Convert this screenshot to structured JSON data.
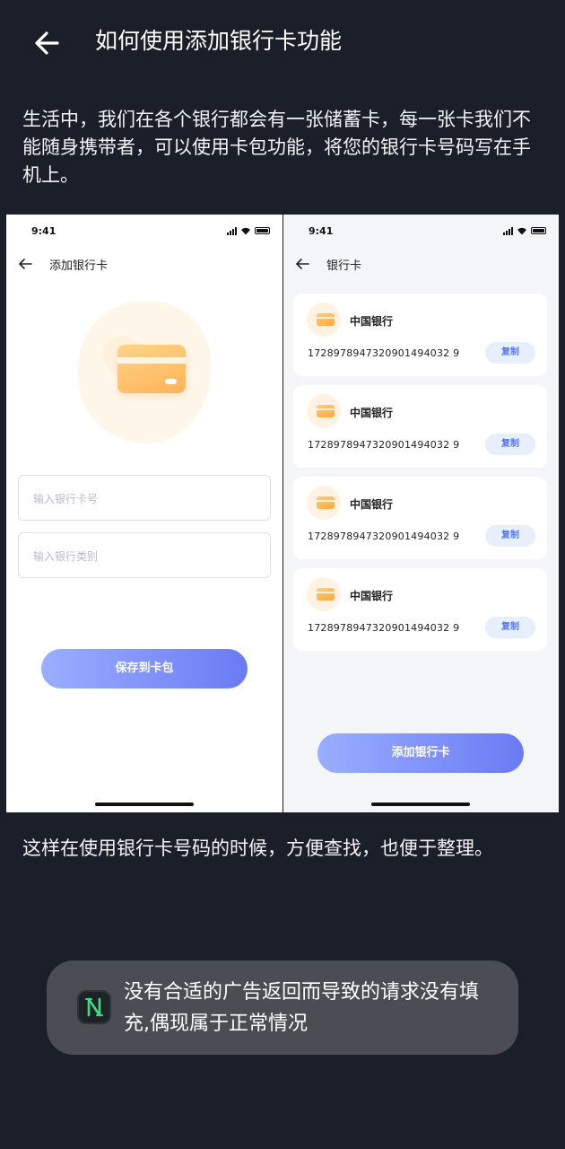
{
  "header": {
    "back_icon": "arrow-left-icon",
    "title": "如何使用添加银行卡功能"
  },
  "intro_text": "生活中，我们在各个银行都会有一张储蓄卡，每一张卡我们不能随身携带者，可以使用卡包功能，将您的银行卡号码写在手机上。",
  "left_screen": {
    "status_time": "9:41",
    "title": "添加银行卡",
    "card_number_placeholder": "输入银行卡号",
    "card_type_placeholder": "输入银行类别",
    "save_button": "保存到卡包"
  },
  "right_screen": {
    "status_time": "9:41",
    "title": "银行卡",
    "cards": [
      {
        "bank": "中国银行",
        "number": "1728978947320901494032 9",
        "copy": "复制"
      },
      {
        "bank": "中国银行",
        "number": "1728978947320901494032 9",
        "copy": "复制"
      },
      {
        "bank": "中国银行",
        "number": "1728978947320901494032 9",
        "copy": "复制"
      },
      {
        "bank": "中国银行",
        "number": "1728978947320901494032 9",
        "copy": "复制"
      }
    ],
    "add_button": "添加银行卡"
  },
  "outro_text": "这样在使用银行卡号码的时候，方便查找，也便于整理。",
  "toast": {
    "icon": "n-logo-icon",
    "message": "没有合适的广告返回而导致的请求没有填充,偶现属于正常情况"
  },
  "colors": {
    "background": "#1b1f29",
    "accent_start": "#9aaeff",
    "accent_end": "#6a7bf3",
    "card_orange": "#ffb356",
    "logo_green": "#3ddc84"
  }
}
